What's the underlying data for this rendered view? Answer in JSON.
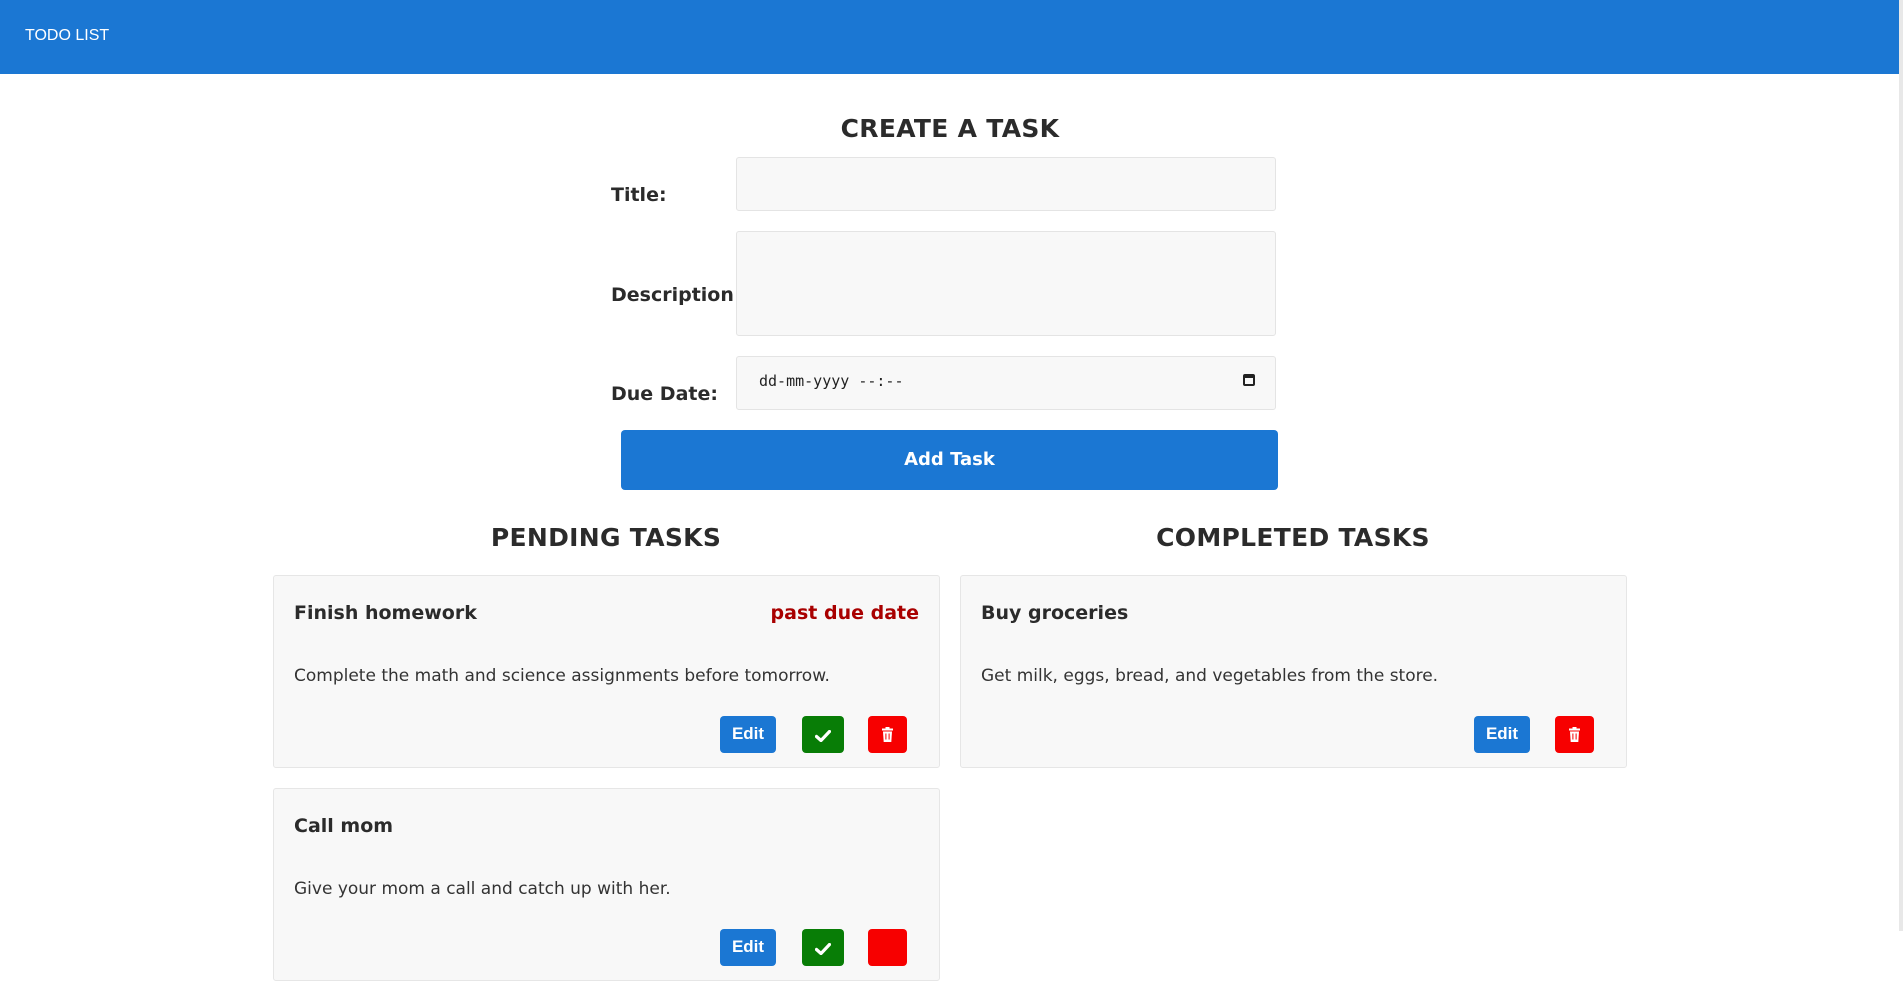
{
  "navbar": {
    "brand": "TODO LIST"
  },
  "create": {
    "heading": "CREATE A TASK",
    "title_label": "Title:",
    "title_value": "",
    "description_label": "Description:",
    "description_value": "",
    "due_label": "Due Date:",
    "due_placeholder": "dd-mm-yyyy --:--",
    "add_button": "Add Task"
  },
  "pending": {
    "heading": "PENDING TASKS",
    "tasks": [
      {
        "title": "Finish homework",
        "status": "past due date",
        "description": "Complete the math and science assignments before tomorrow.",
        "edit_label": "Edit"
      },
      {
        "title": "Call mom",
        "description": "Give your mom a call and catch up with her.",
        "edit_label": "Edit"
      }
    ]
  },
  "completed": {
    "heading": "COMPLETED TASKS",
    "tasks": [
      {
        "title": "Buy groceries",
        "description": "Get milk, eggs, bread, and vegetables from the store.",
        "edit_label": "Edit"
      }
    ]
  },
  "colors": {
    "primary": "#1b77d3",
    "success": "#087d06",
    "danger": "#f70000",
    "past_due": "#a90000",
    "card_bg": "#f8f8f8"
  },
  "icons": {
    "complete": "check-icon",
    "delete": "trash-icon",
    "date": "calendar-icon"
  }
}
